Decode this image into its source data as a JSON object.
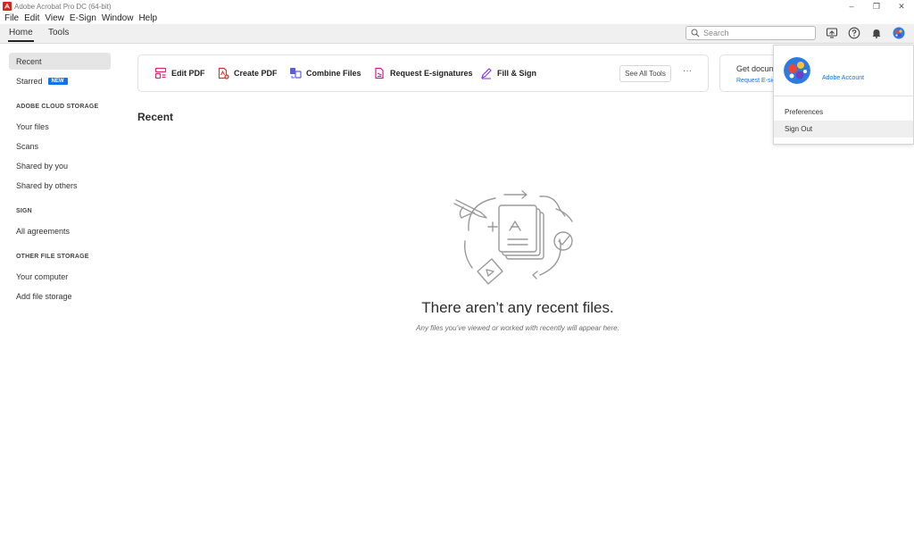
{
  "window": {
    "title": "Adobe Acrobat Pro DC (64-bit)",
    "minimize": "–",
    "restore": "❐",
    "close": "✕"
  },
  "menu": [
    "File",
    "Edit",
    "View",
    "E-Sign",
    "Window",
    "Help"
  ],
  "nav": {
    "tabs": [
      "Home",
      "Tools"
    ],
    "active_tab": "Home",
    "search_placeholder": "Search"
  },
  "sidebar": {
    "items": [
      {
        "label": "Recent",
        "active": true
      },
      {
        "label": "Starred",
        "badge": "NEW"
      }
    ],
    "sections": [
      {
        "heading": "ADOBE CLOUD STORAGE",
        "items": [
          "Your files",
          "Scans",
          "Shared by you",
          "Shared by others"
        ]
      },
      {
        "heading": "SIGN",
        "items": [
          "All agreements"
        ]
      },
      {
        "heading": "OTHER FILE STORAGE",
        "items": [
          "Your computer",
          "Add file storage"
        ]
      }
    ]
  },
  "tools_bar": {
    "tools": [
      "Edit PDF",
      "Create PDF",
      "Combine Files",
      "Request E-signatures",
      "Fill & Sign"
    ],
    "see_all": "See All Tools",
    "more": "···"
  },
  "promo": {
    "title": "Get docum",
    "link": "Request E-sig"
  },
  "main": {
    "section_title": "Recent",
    "empty_title": "There aren’t any recent files.",
    "empty_subtitle": "Any files you’ve viewed or worked with recently will appear here."
  },
  "account_menu": {
    "account_label": "Adobe Account",
    "items": [
      "Preferences",
      "Sign Out"
    ]
  },
  "colors": {
    "accent_blue": "#1473e6",
    "acrobat_red": "#d4261c",
    "edit_pink": "#e8246d",
    "create_red": "#e0302a",
    "combine_blue": "#5c5ce0",
    "esign_pink": "#d6188e",
    "fill_purple": "#8a3ee0"
  }
}
